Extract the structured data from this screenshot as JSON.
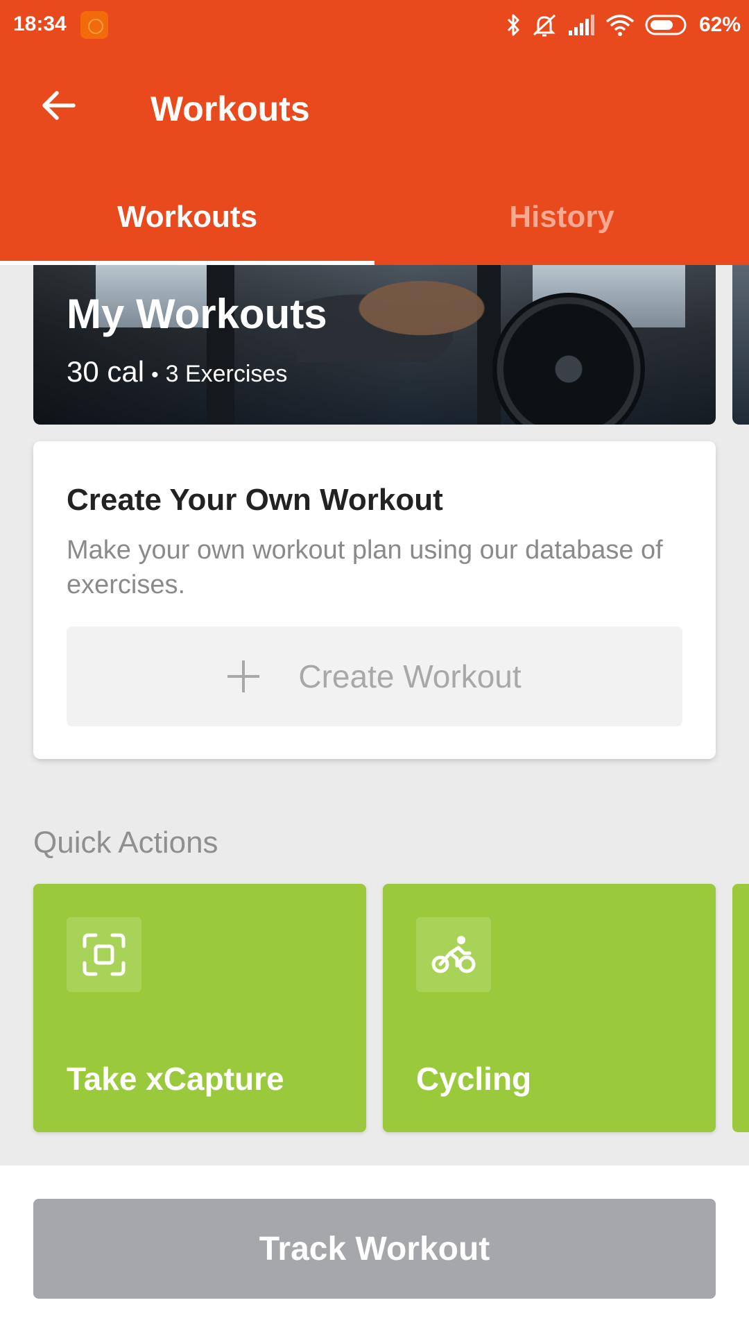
{
  "status_bar": {
    "time": "18:34",
    "battery": "62%",
    "icons": [
      "app-notification-icon",
      "bluetooth-icon",
      "mute-icon",
      "signal-icon",
      "wifi-icon",
      "battery-icon"
    ]
  },
  "toolbar": {
    "title": "Workouts",
    "back_icon": "arrow-left-icon"
  },
  "tabs": [
    {
      "label": "Workouts",
      "active": true
    },
    {
      "label": "History",
      "active": false
    }
  ],
  "hero": {
    "title": "My Workouts",
    "calories": "30 cal",
    "separator": "•",
    "exercises": "3 Exercises"
  },
  "create_card": {
    "title": "Create Your Own Workout",
    "description": "Make your own workout plan using our database of exercises.",
    "button_label": "Create Workout",
    "button_icon": "plus-icon"
  },
  "quick_actions": {
    "heading": "Quick Actions",
    "items": [
      {
        "label": "Take xCapture",
        "icon": "scan-capture-icon"
      },
      {
        "label": "Cycling",
        "icon": "cycling-icon"
      }
    ]
  },
  "bottom": {
    "track_label": "Track Workout"
  },
  "colors": {
    "primary": "#e8491d",
    "tab_inactive": "#f7a992",
    "quick_action": "#9aca3c",
    "track_button": "#a6a7ab",
    "background": "#ebebeb"
  }
}
